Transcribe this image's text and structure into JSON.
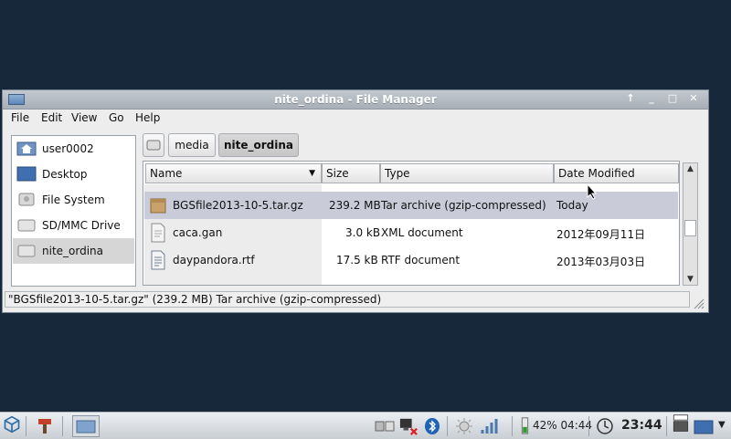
{
  "window": {
    "title": "nite_ordina - File Manager",
    "controls": [
      "↑",
      "_",
      "□",
      "✕"
    ]
  },
  "menu": [
    "File",
    "Edit",
    "View",
    "Go",
    "Help"
  ],
  "side_pane": {
    "items": [
      {
        "label": "user0002",
        "icon": "home-folder-icon"
      },
      {
        "label": "Desktop",
        "icon": "desktop-icon"
      },
      {
        "label": "File System",
        "icon": "harddisk-icon"
      },
      {
        "label": "SD/MMC Drive",
        "icon": "drive-icon"
      },
      {
        "label": "nite_ordina",
        "icon": "drive-icon",
        "selected": true
      }
    ]
  },
  "path_bar": {
    "segments": [
      "media",
      "nite_ordina"
    ]
  },
  "file_list": {
    "columns": [
      "Name",
      "Size",
      "Type",
      "Date Modified"
    ],
    "rows": [
      {
        "name": "BGSfile2013-10-5.tar.gz",
        "size": "239.2 MB",
        "type": "Tar archive (gzip-compressed)",
        "modified": "Today",
        "icon": "archive-icon",
        "selected": true
      },
      {
        "name": "caca.gan",
        "size": "3.0 kB",
        "type": "XML document",
        "modified": "2012年09月11日",
        "icon": "document-icon"
      },
      {
        "name": "daypandora.rtf",
        "size": "17.5 kB",
        "type": "RTF document",
        "modified": "2013年03月03日",
        "icon": "text-document-icon"
      }
    ]
  },
  "status": "\"BGSfile2013-10-5.tar.gz\" (239.2 MB) Tar archive (gzip-compressed)",
  "taskbar": {
    "battery": "42% 04:44",
    "clock": "23:44"
  }
}
